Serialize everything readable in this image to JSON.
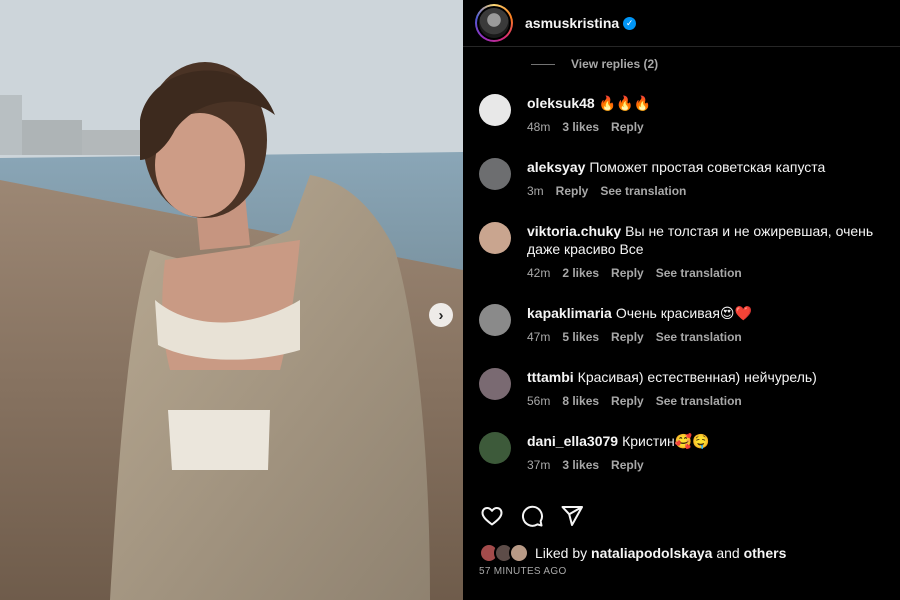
{
  "post": {
    "owner": "asmuskristina",
    "verified_icon": "verified-badge-icon",
    "carousel_next_icon": "chevron-right-icon"
  },
  "view_replies": "View replies (2)",
  "comments": [
    {
      "user": "oleksuk48",
      "text": "🔥🔥🔥",
      "time": "48m",
      "likes": "3 likes",
      "reply": "Reply",
      "translation": "",
      "avatar_color": "#e8e8e8"
    },
    {
      "user": "aleksyay",
      "text": "Поможет простая советская капуста",
      "time": "3m",
      "likes": "",
      "reply": "Reply",
      "translation": "See translation",
      "avatar_color": "#6d6e70"
    },
    {
      "user": "viktoria.chuky",
      "text": "Вы не толстая и не ожиревшая, очень даже красиво Все",
      "time": "42m",
      "likes": "2 likes",
      "reply": "Reply",
      "translation": "See translation",
      "avatar_color": "#c9a58f"
    },
    {
      "user": "kapaklimaria",
      "text": "Очень красивая😍❤️",
      "time": "47m",
      "likes": "5 likes",
      "reply": "Reply",
      "translation": "See translation",
      "avatar_color": "#8a8a8a"
    },
    {
      "user": "tttambi",
      "text": "Красивая) естественная) нейчурель)",
      "time": "56m",
      "likes": "8 likes",
      "reply": "Reply",
      "translation": "See translation",
      "avatar_color": "#7a6a72"
    },
    {
      "user": "dani_ella3079",
      "text": "Кристин🥰🤤",
      "time": "37m",
      "likes": "3 likes",
      "reply": "Reply",
      "translation": "",
      "avatar_color": "#3d5a3a"
    }
  ],
  "actions": {
    "like_icon": "heart-icon",
    "comment_icon": "comment-icon",
    "share_icon": "send-icon"
  },
  "likes": {
    "prefix": "Liked by",
    "user": "nataliapodolskaya",
    "and": "and",
    "others": "others"
  },
  "timestamp": "57 MINUTES AGO",
  "colors": {
    "background": "#000000",
    "text_primary": "#f5f5f5",
    "text_secondary": "#a8a8a8",
    "divider": "#262626",
    "verified": "#0095f6"
  }
}
